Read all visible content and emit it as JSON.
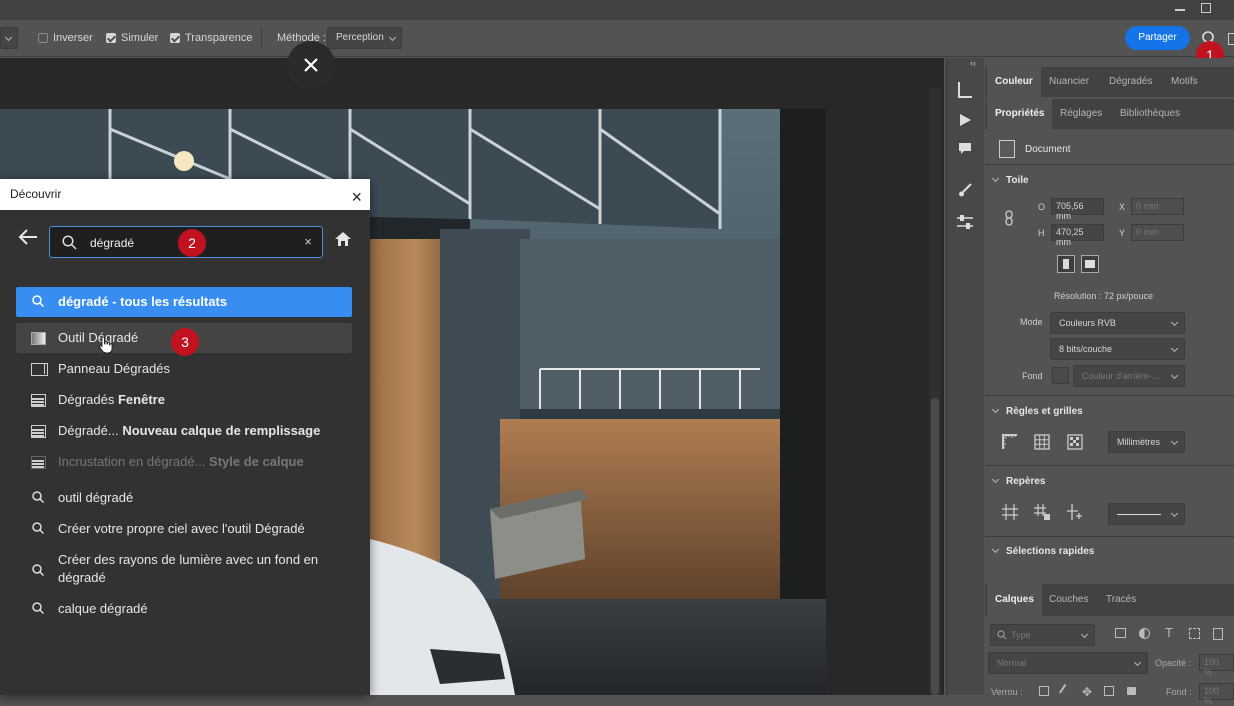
{
  "options_bar": {
    "invert_label": "Inverser",
    "simulate_label": "Simuler",
    "transparency_label": "Transparence",
    "method_label": "Méthode :",
    "method_value": "Perception",
    "share_label": "Partager"
  },
  "markers": {
    "one": "1",
    "two": "2",
    "three": "3"
  },
  "right_panel": {
    "top_tabs": [
      "Couleur",
      "Nuancier",
      "Dégradés",
      "Motifs"
    ],
    "prop_tabs": [
      "Propriétés",
      "Réglages",
      "Bibliothèques"
    ],
    "document_label": "Document",
    "canvas_section": "Toile",
    "width_label": "O",
    "width_value": "705,56 mm",
    "height_label": "H",
    "height_value": "470,25 mm",
    "x_label": "X",
    "x_placeholder": "0 mm",
    "y_label": "Y",
    "y_placeholder": "0 mm",
    "resolution": "Résolution : 72 px/pouce",
    "mode_label": "Mode",
    "mode_value": "Couleurs RVB",
    "depth_value": "8 bits/couche",
    "background_label": "Fond",
    "background_value": "Couleur d'arrière-...",
    "rulers_section": "Règles et grilles",
    "units_value": "Millimètres",
    "guides_section": "Repères",
    "quick_select_section": "Sélections rapides",
    "layer_tabs": [
      "Calques",
      "Couches",
      "Tracés"
    ],
    "layer_search_placeholder": "Type",
    "blend_mode": "Normal",
    "opacity_label": "Opacité :",
    "opacity_value": "100 %",
    "lock_label": "Verrou :",
    "fill_label": "Fond :",
    "fill_value": "100 %"
  },
  "dialog": {
    "title": "Découvrir",
    "search_value": "dégradé",
    "results": [
      {
        "pre": "dégradé - tous les résultats",
        "bold": ""
      },
      {
        "pre": "Outil Dégradé",
        "bold": ""
      },
      {
        "pre": "Panneau Dégradés",
        "bold": ""
      },
      {
        "pre": "Dégradés ",
        "bold": "Fenêtre"
      },
      {
        "pre": "Dégradé... ",
        "bold": "Nouveau calque de remplissage"
      },
      {
        "pre": "Incrustation en dégradé... ",
        "bold": "Style de calque"
      },
      {
        "pre": "outil dégradé",
        "bold": ""
      },
      {
        "pre": "Créer votre propre ciel avec l'outil Dégradé",
        "bold": ""
      },
      {
        "pre": "Créer des rayons de lumière avec un fond en dégradé",
        "bold": ""
      },
      {
        "pre": "calque dégradé",
        "bold": ""
      }
    ]
  }
}
